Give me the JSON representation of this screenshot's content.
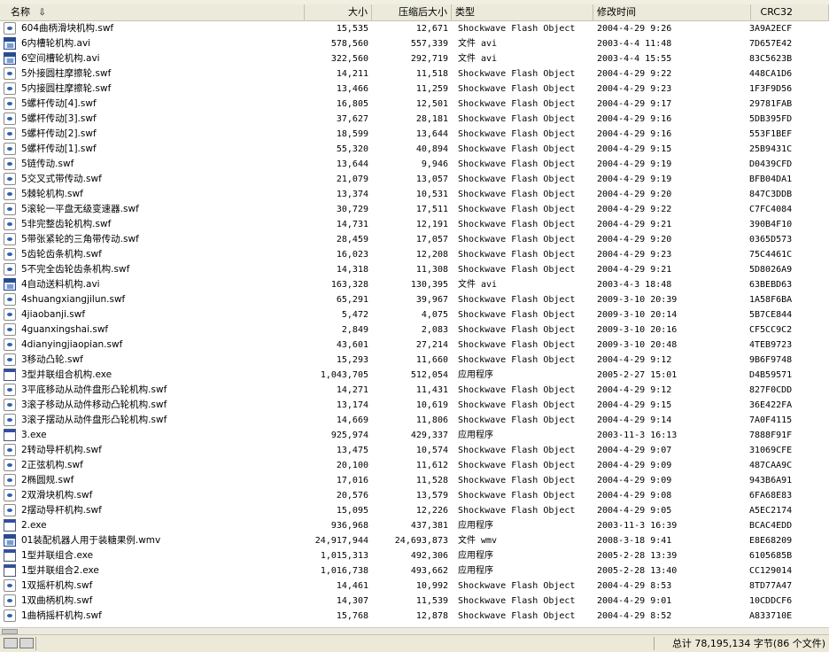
{
  "columns": {
    "name": "名称",
    "size": "大小",
    "compressed": "压缩后大小",
    "type": "类型",
    "modified": "修改时间",
    "crc": "CRC32"
  },
  "files": [
    {
      "icon": "flash-file-icon",
      "name": "604曲柄滑块机构.swf",
      "size": "15,535",
      "comp": "12,671",
      "type": "Shockwave Flash Object",
      "date": "2004-4-29 9:26",
      "crc": "3A9A2ECF"
    },
    {
      "icon": "video-file-icon",
      "name": "6内槽轮机构.avi",
      "size": "578,560",
      "comp": "557,339",
      "type": "文件 avi",
      "date": "2003-4-4 11:48",
      "crc": "7D657E42"
    },
    {
      "icon": "video-file-icon",
      "name": "6空间槽轮机构.avi",
      "size": "322,560",
      "comp": "292,719",
      "type": "文件 avi",
      "date": "2003-4-4 15:55",
      "crc": "83C5623B"
    },
    {
      "icon": "flash-file-icon",
      "name": "5外接圆柱摩擦轮.swf",
      "size": "14,211",
      "comp": "11,518",
      "type": "Shockwave Flash Object",
      "date": "2004-4-29 9:22",
      "crc": "448CA1D6"
    },
    {
      "icon": "flash-file-icon",
      "name": "5内接圆柱摩擦轮.swf",
      "size": "13,466",
      "comp": "11,259",
      "type": "Shockwave Flash Object",
      "date": "2004-4-29 9:23",
      "crc": "1F3F9D56"
    },
    {
      "icon": "flash-file-icon",
      "name": "5螺杆传动[4].swf",
      "size": "16,805",
      "comp": "12,501",
      "type": "Shockwave Flash Object",
      "date": "2004-4-29 9:17",
      "crc": "29781FAB"
    },
    {
      "icon": "flash-file-icon",
      "name": "5螺杆传动[3].swf",
      "size": "37,627",
      "comp": "28,181",
      "type": "Shockwave Flash Object",
      "date": "2004-4-29 9:16",
      "crc": "5DB395FD"
    },
    {
      "icon": "flash-file-icon",
      "name": "5螺杆传动[2].swf",
      "size": "18,599",
      "comp": "13,644",
      "type": "Shockwave Flash Object",
      "date": "2004-4-29 9:16",
      "crc": "553F1BEF"
    },
    {
      "icon": "flash-file-icon",
      "name": "5螺杆传动[1].swf",
      "size": "55,320",
      "comp": "40,894",
      "type": "Shockwave Flash Object",
      "date": "2004-4-29 9:15",
      "crc": "25B9431C"
    },
    {
      "icon": "flash-file-icon",
      "name": "5链传动.swf",
      "size": "13,644",
      "comp": "9,946",
      "type": "Shockwave Flash Object",
      "date": "2004-4-29 9:19",
      "crc": "D0439CFD"
    },
    {
      "icon": "flash-file-icon",
      "name": "5交叉式带传动.swf",
      "size": "21,079",
      "comp": "13,057",
      "type": "Shockwave Flash Object",
      "date": "2004-4-29 9:19",
      "crc": "BFB04DA1"
    },
    {
      "icon": "flash-file-icon",
      "name": "5棘轮机构.swf",
      "size": "13,374",
      "comp": "10,531",
      "type": "Shockwave Flash Object",
      "date": "2004-4-29 9:20",
      "crc": "847C3DDB"
    },
    {
      "icon": "flash-file-icon",
      "name": "5滚轮一平盘无级变速器.swf",
      "size": "30,729",
      "comp": "17,511",
      "type": "Shockwave Flash Object",
      "date": "2004-4-29 9:22",
      "crc": "C7FC4084"
    },
    {
      "icon": "flash-file-icon",
      "name": "5非完整齿轮机构.swf",
      "size": "14,731",
      "comp": "12,191",
      "type": "Shockwave Flash Object",
      "date": "2004-4-29 9:21",
      "crc": "390B4F10"
    },
    {
      "icon": "flash-file-icon",
      "name": "5带张紧轮的三角带传动.swf",
      "size": "28,459",
      "comp": "17,057",
      "type": "Shockwave Flash Object",
      "date": "2004-4-29 9:20",
      "crc": "0365D573"
    },
    {
      "icon": "flash-file-icon",
      "name": "5齿轮齿条机构.swf",
      "size": "16,023",
      "comp": "12,208",
      "type": "Shockwave Flash Object",
      "date": "2004-4-29 9:23",
      "crc": "75C4461C"
    },
    {
      "icon": "flash-file-icon",
      "name": "5不完全齿轮齿条机构.swf",
      "size": "14,318",
      "comp": "11,308",
      "type": "Shockwave Flash Object",
      "date": "2004-4-29 9:21",
      "crc": "5D8026A9"
    },
    {
      "icon": "video-file-icon",
      "name": "4自动送料机构.avi",
      "size": "163,328",
      "comp": "130,395",
      "type": "文件 avi",
      "date": "2003-4-3 18:48",
      "crc": "63BEBD63"
    },
    {
      "icon": "flash-file-icon",
      "name": "4shuangxiangjilun.swf",
      "size": "65,291",
      "comp": "39,967",
      "type": "Shockwave Flash Object",
      "date": "2009-3-10 20:39",
      "crc": "1A58F6BA"
    },
    {
      "icon": "flash-file-icon",
      "name": "4jiaobanji.swf",
      "size": "5,472",
      "comp": "4,075",
      "type": "Shockwave Flash Object",
      "date": "2009-3-10 20:14",
      "crc": "5B7CE844"
    },
    {
      "icon": "flash-file-icon",
      "name": "4guanxingshai.swf",
      "size": "2,849",
      "comp": "2,083",
      "type": "Shockwave Flash Object",
      "date": "2009-3-10 20:16",
      "crc": "CF5CC9C2"
    },
    {
      "icon": "flash-file-icon",
      "name": "4dianyingjiaopian.swf",
      "size": "43,601",
      "comp": "27,214",
      "type": "Shockwave Flash Object",
      "date": "2009-3-10 20:48",
      "crc": "4TEB9723"
    },
    {
      "icon": "flash-file-icon",
      "name": "3移动凸轮.swf",
      "size": "15,293",
      "comp": "11,660",
      "type": "Shockwave Flash Object",
      "date": "2004-4-29 9:12",
      "crc": "9B6F9748"
    },
    {
      "icon": "exe-file-icon",
      "name": "3型并联组合机构.exe",
      "size": "1,043,705",
      "comp": "512,054",
      "type": "应用程序",
      "date": "2005-2-27 15:01",
      "crc": "D4B59571"
    },
    {
      "icon": "flash-file-icon",
      "name": "3平底移动从动件盘形凸轮机构.swf",
      "size": "14,271",
      "comp": "11,431",
      "type": "Shockwave Flash Object",
      "date": "2004-4-29 9:12",
      "crc": "827F0CDD"
    },
    {
      "icon": "flash-file-icon",
      "name": "3滚子移动从动件移动凸轮机构.swf",
      "size": "13,174",
      "comp": "10,619",
      "type": "Shockwave Flash Object",
      "date": "2004-4-29 9:15",
      "crc": "36E422FA"
    },
    {
      "icon": "flash-file-icon",
      "name": "3滚子摆动从动件盘形凸轮机构.swf",
      "size": "14,669",
      "comp": "11,806",
      "type": "Shockwave Flash Object",
      "date": "2004-4-29 9:14",
      "crc": "7A0F4115"
    },
    {
      "icon": "exe-file-icon",
      "name": "3.exe",
      "size": "925,974",
      "comp": "429,337",
      "type": "应用程序",
      "date": "2003-11-3 16:13",
      "crc": "7888F91F"
    },
    {
      "icon": "flash-file-icon",
      "name": "2转动导杆机构.swf",
      "size": "13,475",
      "comp": "10,574",
      "type": "Shockwave Flash Object",
      "date": "2004-4-29 9:07",
      "crc": "31069CFE"
    },
    {
      "icon": "flash-file-icon",
      "name": "2正弦机构.swf",
      "size": "20,100",
      "comp": "11,612",
      "type": "Shockwave Flash Object",
      "date": "2004-4-29 9:09",
      "crc": "487CAA9C"
    },
    {
      "icon": "flash-file-icon",
      "name": "2椭圆规.swf",
      "size": "17,016",
      "comp": "11,528",
      "type": "Shockwave Flash Object",
      "date": "2004-4-29 9:09",
      "crc": "943B6A91"
    },
    {
      "icon": "flash-file-icon",
      "name": "2双滑块机构.swf",
      "size": "20,576",
      "comp": "13,579",
      "type": "Shockwave Flash Object",
      "date": "2004-4-29 9:08",
      "crc": "6FA68E83"
    },
    {
      "icon": "flash-file-icon",
      "name": "2摆动导杆机构.swf",
      "size": "15,095",
      "comp": "12,226",
      "type": "Shockwave Flash Object",
      "date": "2004-4-29 9:05",
      "crc": "A5EC2174"
    },
    {
      "icon": "exe-file-icon",
      "name": "2.exe",
      "size": "936,968",
      "comp": "437,381",
      "type": "应用程序",
      "date": "2003-11-3 16:39",
      "crc": "BCAC4EDD"
    },
    {
      "icon": "video-file-icon",
      "name": "01装配机器人用于装糖果例.wmv",
      "size": "24,917,944",
      "comp": "24,693,873",
      "type": "文件 wmv",
      "date": "2008-3-18 9:41",
      "crc": "E8E68209"
    },
    {
      "icon": "exe-file-icon",
      "name": "1型并联组合.exe",
      "size": "1,015,313",
      "comp": "492,306",
      "type": "应用程序",
      "date": "2005-2-28 13:39",
      "crc": "6105685B"
    },
    {
      "icon": "exe-file-icon",
      "name": "1型并联组合2.exe",
      "size": "1,016,738",
      "comp": "493,662",
      "type": "应用程序",
      "date": "2005-2-28 13:40",
      "crc": "CC129014"
    },
    {
      "icon": "flash-file-icon",
      "name": "1双摇杆机构.swf",
      "size": "14,461",
      "comp": "10,992",
      "type": "Shockwave Flash Object",
      "date": "2004-4-29 8:53",
      "crc": "8TD77A47"
    },
    {
      "icon": "flash-file-icon",
      "name": "1双曲柄机构.swf",
      "size": "14,307",
      "comp": "11,539",
      "type": "Shockwave Flash Object",
      "date": "2004-4-29 9:01",
      "crc": "10CDDCF6"
    },
    {
      "icon": "flash-file-icon",
      "name": "1曲柄摇杆机构.swf",
      "size": "15,768",
      "comp": "12,878",
      "type": "Shockwave Flash Object",
      "date": "2004-4-29 8:52",
      "crc": "A833710E"
    }
  ],
  "status": {
    "summary": "总计 78,195,134 字节(86 个文件)"
  }
}
